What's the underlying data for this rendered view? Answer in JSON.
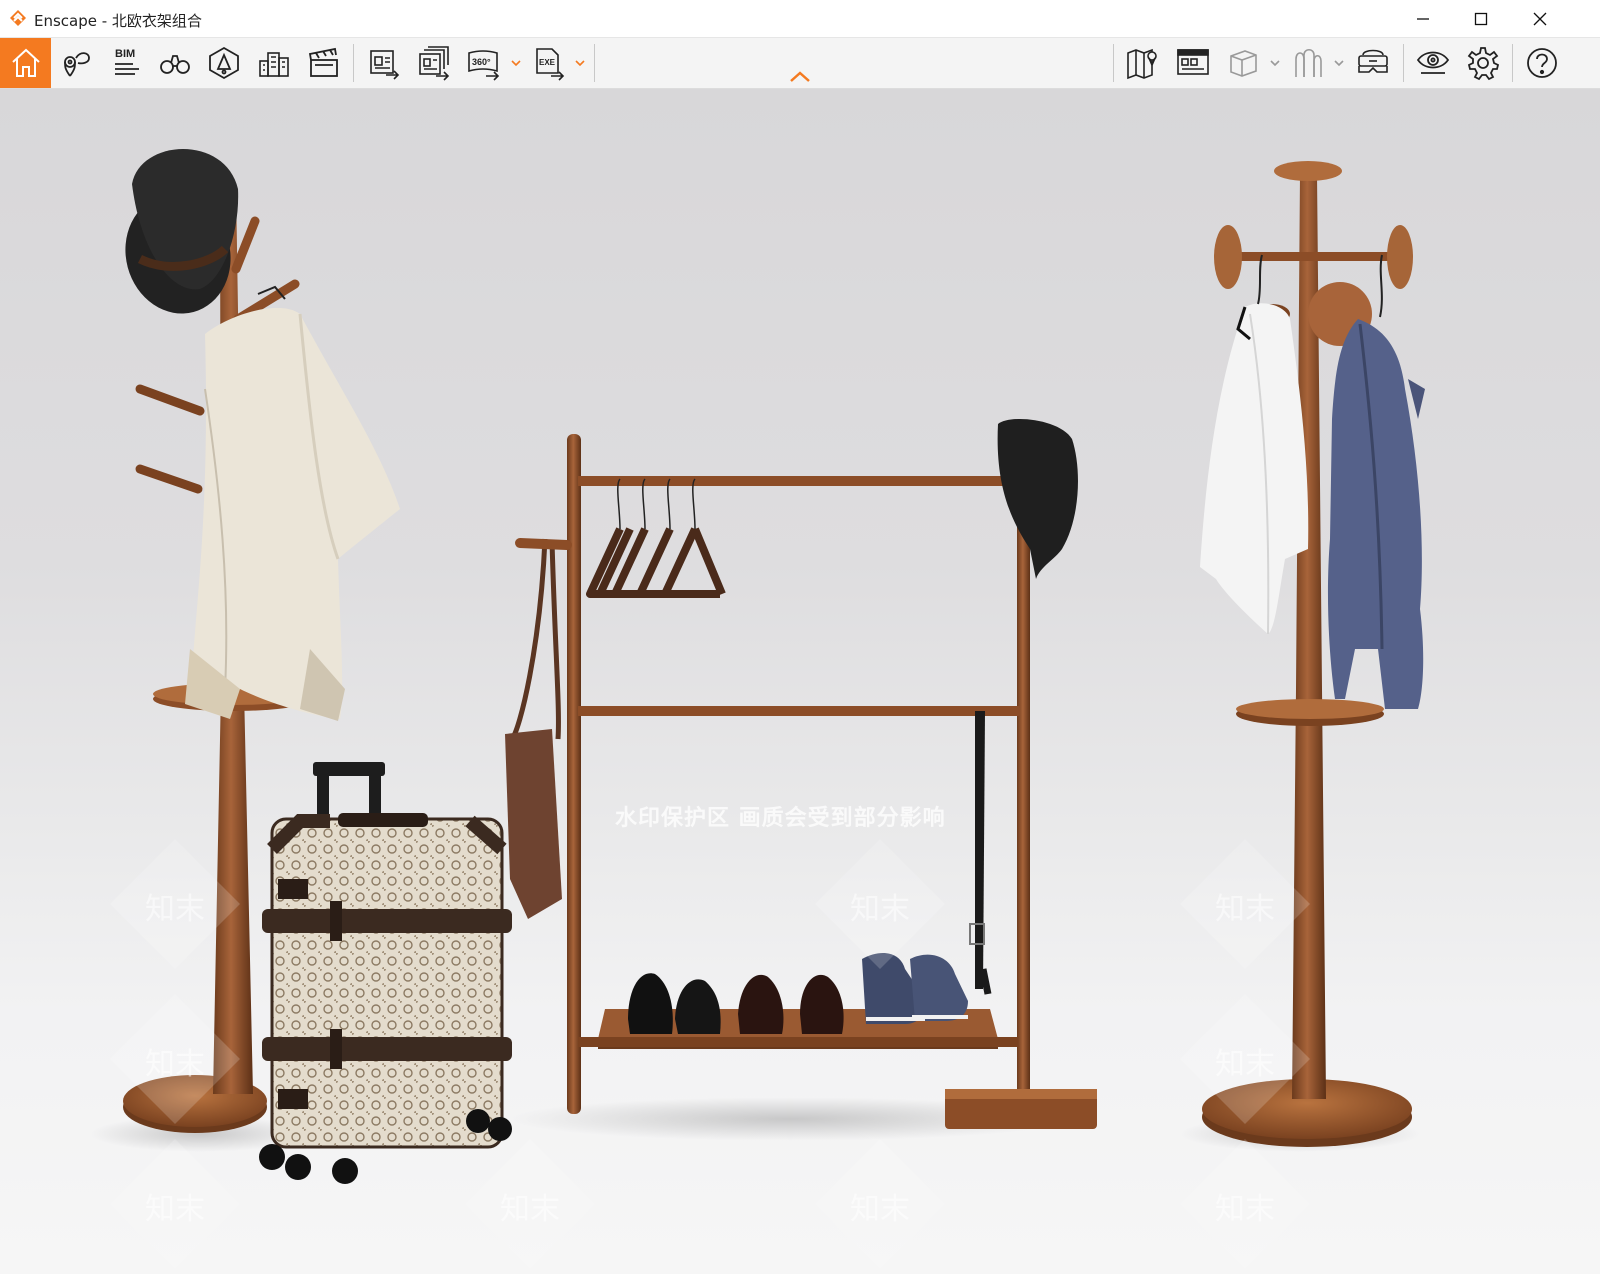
{
  "window": {
    "app_name": "Enscape",
    "title": "Enscape - 北欧衣架组合",
    "controls": [
      "minimize",
      "maximize",
      "close"
    ]
  },
  "toolbar": {
    "left_icons": [
      "home-icon",
      "location-pin-icon",
      "bim-icon",
      "binoculars-icon",
      "visual-settings-icon",
      "buildings-icon",
      "clapperboard-icon"
    ],
    "bim_label": "BIM",
    "export_icons": [
      "screenshot-export-icon",
      "batch-export-icon",
      "panorama-360-export-icon",
      "exe-export-icon"
    ],
    "panorama_label": "360°",
    "exe_label": "EXE",
    "right_icons": [
      "map-icon",
      "asset-library-icon",
      "cube-icon",
      "sculpture-icon",
      "vr-headset-icon",
      "eye-icon",
      "gear-icon",
      "help-icon"
    ],
    "accent_color": "#f47a20",
    "active_item": "home"
  },
  "viewport": {
    "watermark": "水印保护区  画质会受到部分影响",
    "watermark_logo": "知末"
  }
}
